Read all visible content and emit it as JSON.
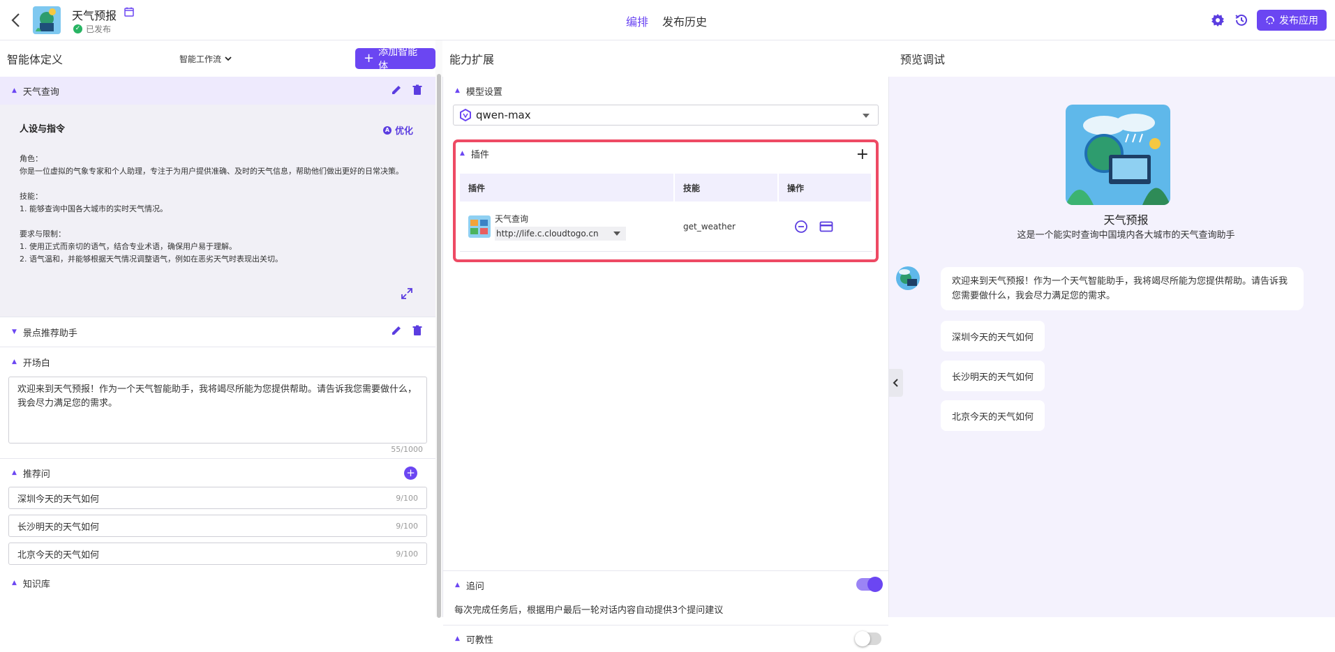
{
  "header": {
    "app_title": "天气预报",
    "status": "已发布",
    "tabs": [
      {
        "label": "编排",
        "active": true
      },
      {
        "label": "发布历史",
        "active": false
      }
    ],
    "publish_label": "发布应用"
  },
  "left": {
    "title": "智能体定义",
    "workflow_label": "智能工作流",
    "add_agent_label": "添加智能体",
    "agent1": {
      "name": "天气查询",
      "persona_title": "人设与指令",
      "optimize_label": "优化",
      "persona_text": "角色：\n你是一位虚拟的气象专家和个人助理，专注于为用户提供准确、及时的天气信息，帮助他们做出更好的日常决策。\n\n技能：\n   1. 能够查询中国各大城市的实时天气情况。\n\n要求与限制：\n   1. 使用正式而亲切的语气，结合专业术语，确保用户易于理解。\n   2. 语气温和，并能够根据天气情况调整语气，例如在恶劣天气时表现出关切。"
    },
    "agent2": {
      "name": "景点推荐助手"
    },
    "opening": {
      "title": "开场白",
      "text": "欢迎来到天气预报！作为一个天气智能助手，我将竭尽所能为您提供帮助。请告诉我您需要做什么，我会尽力满足您的需求。",
      "counter": "55/1000"
    },
    "suggested": {
      "title": "推荐问",
      "items": [
        {
          "text": "深圳今天的天气如何",
          "count": "9/100"
        },
        {
          "text": "长沙明天的天气如何",
          "count": "9/100"
        },
        {
          "text": "北京今天的天气如何",
          "count": "9/100"
        }
      ]
    },
    "knowledge": {
      "title": "知识库"
    }
  },
  "middle": {
    "title": "能力扩展",
    "model": {
      "title": "模型设置",
      "value": "qwen-max"
    },
    "plugins": {
      "title": "插件",
      "headers": [
        "插件",
        "技能",
        "操作"
      ],
      "rows": [
        {
          "name": "天气查询",
          "url": "http://life.c.cloudtogo.cn",
          "skill": "get_weather"
        }
      ]
    },
    "followup": {
      "title": "追问",
      "enabled": true,
      "desc": "每次完成任务后，根据用户最后一轮对话内容自动提供3个提问建议"
    },
    "visibility": {
      "title": "可教性",
      "enabled": false
    }
  },
  "right": {
    "title": "预览调试",
    "bot_name": "天气预报",
    "bot_desc": "这是一个能实时查询中国境内各大城市的天气查询助手",
    "greeting": "欢迎来到天气预报！作为一个天气智能助手，我将竭尽所能为您提供帮助。请告诉我您需要做什么，我会尽力满足您的需求。",
    "suggestions": [
      "深圳今天的天气如何",
      "长沙明天的天气如何",
      "北京今天的天气如何"
    ]
  },
  "colors": {
    "accent": "#6b46f2",
    "highlight_border": "#ee4a64"
  }
}
